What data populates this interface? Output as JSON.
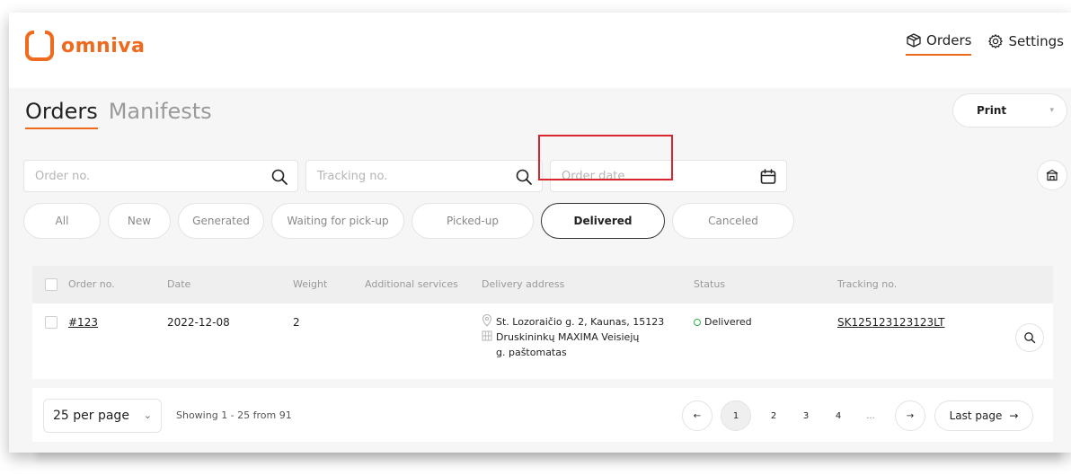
{
  "header": {
    "brand": "omniva",
    "nav": [
      {
        "label": "Orders",
        "icon": "box-icon",
        "active": true
      },
      {
        "label": "Settings",
        "icon": "gear-icon",
        "active": false
      }
    ]
  },
  "page": {
    "tabs": [
      {
        "label": "Orders",
        "active": true
      },
      {
        "label": "Manifests",
        "active": false
      }
    ],
    "print_label": "Print"
  },
  "filters": {
    "order_placeholder": "Order no.",
    "tracking_placeholder": "Tracking no.",
    "date_placeholder": "Order date"
  },
  "status_filters": [
    {
      "label": "All"
    },
    {
      "label": "New"
    },
    {
      "label": "Generated"
    },
    {
      "label": "Waiting for pick-up"
    },
    {
      "label": "Picked-up"
    },
    {
      "label": "Delivered",
      "active": true
    },
    {
      "label": "Canceled"
    }
  ],
  "table": {
    "headers": {
      "order_no": "Order no.",
      "date": "Date",
      "weight": "Weight",
      "services": "Additional services",
      "address": "Delivery address",
      "status": "Status",
      "tracking": "Tracking no."
    },
    "rows": [
      {
        "order_no": "#123",
        "date": "2022-12-08",
        "weight": "2",
        "services": "",
        "address_line1": "St. Lozoraičio g. 2, Kaunas, 15123",
        "address_line2": "Druskininkų MAXIMA Veisiejų",
        "address_line3": "g. paštomatas",
        "status": "Delivered",
        "tracking": "SK125123123123LT"
      }
    ]
  },
  "pagination": {
    "per_page": "25 per page",
    "showing": "Showing 1 - 25 from 91",
    "prev": "←",
    "pages": [
      "1",
      "2",
      "3",
      "4",
      "..."
    ],
    "next": "→",
    "last": "Last page",
    "last_arrow": "→"
  },
  "colors": {
    "brand": "#f06a1d",
    "status_delivered": "#2fb24c",
    "highlight": "#d9262e"
  }
}
